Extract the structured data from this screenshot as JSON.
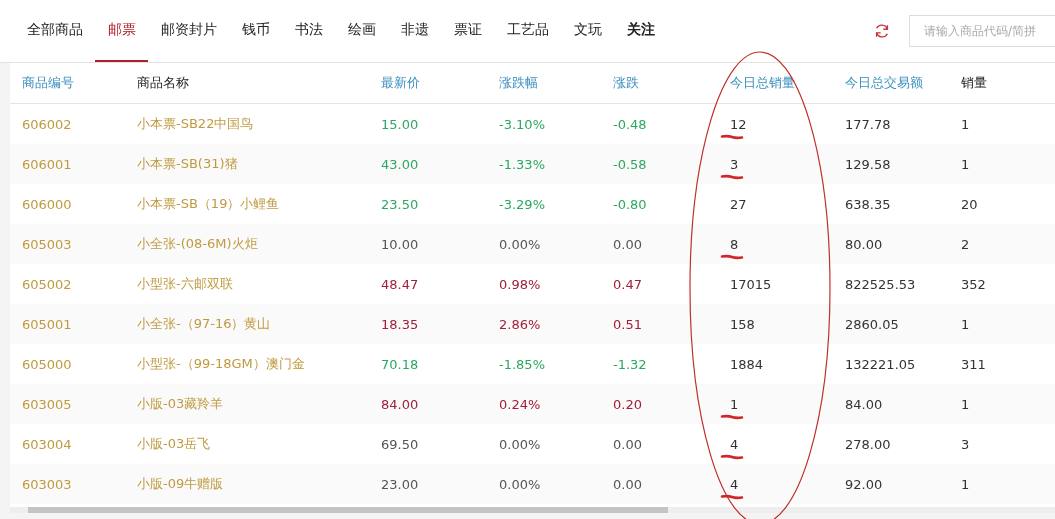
{
  "tabs": [
    {
      "label": "全部商品",
      "selected": false,
      "bold": false
    },
    {
      "label": "邮票",
      "selected": true,
      "bold": false
    },
    {
      "label": "邮资封片",
      "selected": false,
      "bold": false
    },
    {
      "label": "钱币",
      "selected": false,
      "bold": false
    },
    {
      "label": "书法",
      "selected": false,
      "bold": false
    },
    {
      "label": "绘画",
      "selected": false,
      "bold": false
    },
    {
      "label": "非遗",
      "selected": false,
      "bold": false
    },
    {
      "label": "票证",
      "selected": false,
      "bold": false
    },
    {
      "label": "工艺品",
      "selected": false,
      "bold": false
    },
    {
      "label": "文玩",
      "selected": false,
      "bold": false
    },
    {
      "label": "关注",
      "selected": false,
      "bold": true
    }
  ],
  "search": {
    "placeholder": "请输入商品代码/简拼"
  },
  "table": {
    "columns": [
      {
        "label": "商品编号",
        "kind": "link"
      },
      {
        "label": "商品名称",
        "kind": "plain"
      },
      {
        "label": "最新价",
        "kind": "link"
      },
      {
        "label": "涨跌幅",
        "kind": "link"
      },
      {
        "label": "涨跌",
        "kind": "link"
      },
      {
        "label": "今日总销量",
        "kind": "link"
      },
      {
        "label": "今日总交易额",
        "kind": "link"
      },
      {
        "label": "销量",
        "kind": "plain"
      }
    ],
    "rows": [
      {
        "code": "606002",
        "name": "小本票-SB22中国鸟",
        "price": "15.00",
        "pct": "-3.10%",
        "change": "-0.48",
        "today_qty": "12",
        "today_amount": "177.78",
        "qty": "1",
        "color": "#2aa860",
        "marked": true
      },
      {
        "code": "606001",
        "name": "小本票-SB(31)猪",
        "price": "43.00",
        "pct": "-1.33%",
        "change": "-0.58",
        "today_qty": "3",
        "today_amount": "129.58",
        "qty": "1",
        "color": "#2aa860",
        "marked": true
      },
      {
        "code": "606000",
        "name": "小本票-SB（19）小鲤鱼",
        "price": "23.50",
        "pct": "-3.29%",
        "change": "-0.80",
        "today_qty": "27",
        "today_amount": "638.35",
        "qty": "20",
        "color": "#2aa860",
        "marked": false
      },
      {
        "code": "605003",
        "name": "小全张-(08-6M)火炬",
        "price": "10.00",
        "pct": "0.00%",
        "change": "0.00",
        "today_qty": "8",
        "today_amount": "80.00",
        "qty": "2",
        "color": "#555555",
        "marked": true
      },
      {
        "code": "605002",
        "name": "小型张-六邮双联",
        "price": "48.47",
        "pct": "0.98%",
        "change": "0.47",
        "today_qty": "17015",
        "today_amount": "822525.53",
        "qty": "352",
        "color": "#a0203a",
        "marked": false
      },
      {
        "code": "605001",
        "name": "小全张-（97-16）黄山",
        "price": "18.35",
        "pct": "2.86%",
        "change": "0.51",
        "today_qty": "158",
        "today_amount": "2860.05",
        "qty": "1",
        "color": "#a0203a",
        "marked": false
      },
      {
        "code": "605000",
        "name": "小型张-（99-18GM）澳门金",
        "price": "70.18",
        "pct": "-1.85%",
        "change": "-1.32",
        "today_qty": "1884",
        "today_amount": "132221.05",
        "qty": "311",
        "color": "#2aa860",
        "marked": false
      },
      {
        "code": "603005",
        "name": "小版-03藏羚羊",
        "price": "84.00",
        "pct": "0.24%",
        "change": "0.20",
        "today_qty": "1",
        "today_amount": "84.00",
        "qty": "1",
        "color": "#a0203a",
        "marked": true
      },
      {
        "code": "603004",
        "name": "小版-03岳飞",
        "price": "69.50",
        "pct": "0.00%",
        "change": "0.00",
        "today_qty": "4",
        "today_amount": "278.00",
        "qty": "3",
        "color": "#555555",
        "marked": true
      },
      {
        "code": "603003",
        "name": "小版-09牛赠版",
        "price": "23.00",
        "pct": "0.00%",
        "change": "0.00",
        "today_qty": "4",
        "today_amount": "92.00",
        "qty": "1",
        "color": "#555555",
        "marked": true
      }
    ]
  }
}
